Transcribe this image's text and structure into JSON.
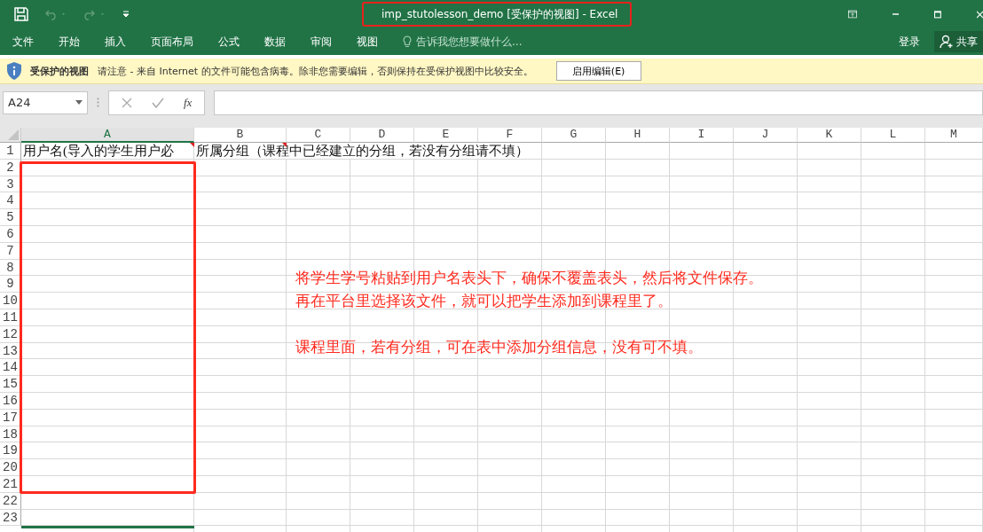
{
  "window": {
    "title": "imp_stutolesson_demo  [受保护的视图] - Excel"
  },
  "quick_access": [
    {
      "kind": "save",
      "disabled": false
    },
    {
      "kind": "undo",
      "disabled": true
    },
    {
      "kind": "redo",
      "disabled": true
    },
    {
      "kind": "customize",
      "disabled": false
    }
  ],
  "ribbon": {
    "tabs": [
      "文件",
      "开始",
      "插入",
      "页面布局",
      "公式",
      "数据",
      "审阅",
      "视图"
    ],
    "tell_me": {
      "placeholder": "告诉我您想要做什么..."
    },
    "sign_in": "登录",
    "share": "共享"
  },
  "protected_bar": {
    "title": "受保护的视图",
    "message": "请注意 - 来自 Internet 的文件可能包含病毒。除非您需要编辑，否则保持在受保护视图中比较安全。",
    "button": "启用编辑(E)"
  },
  "formula_bar": {
    "name_box": "A24",
    "function_label": "fx"
  },
  "columns": [
    "A",
    "B",
    "C",
    "D",
    "E",
    "F",
    "G",
    "H",
    "I",
    "J",
    "K",
    "L",
    "M"
  ],
  "rows": [
    {
      "number": "1",
      "cells": [
        {
          "text": "用户名(导入的学生用户必",
          "comment": true
        },
        {
          "text": "所属分组（课程中已经建立的分组，若没有分组请不填）",
          "comment": true
        }
      ]
    },
    {
      "number": "2"
    },
    {
      "number": "3"
    },
    {
      "number": "4"
    },
    {
      "number": "5"
    },
    {
      "number": "6"
    },
    {
      "number": "7"
    },
    {
      "number": "8"
    },
    {
      "number": "9"
    },
    {
      "number": "10"
    },
    {
      "number": "11"
    },
    {
      "number": "12"
    },
    {
      "number": "13"
    },
    {
      "number": "14"
    },
    {
      "number": "15"
    },
    {
      "number": "16"
    },
    {
      "number": "17"
    },
    {
      "number": "18"
    },
    {
      "number": "19"
    },
    {
      "number": "20"
    },
    {
      "number": "21"
    },
    {
      "number": "22"
    },
    {
      "number": "23"
    }
  ],
  "annotation": {
    "paragraphs": [
      [
        "将学生学号粘贴到用户名表头下，确保不覆盖表头，然后将文件保存。",
        "再在平台里选择该文件，就可以把学生添加到课程里了。"
      ],
      [
        "课程里面，若有分组，可在表中添加分组信息，没有可不填。"
      ]
    ]
  }
}
